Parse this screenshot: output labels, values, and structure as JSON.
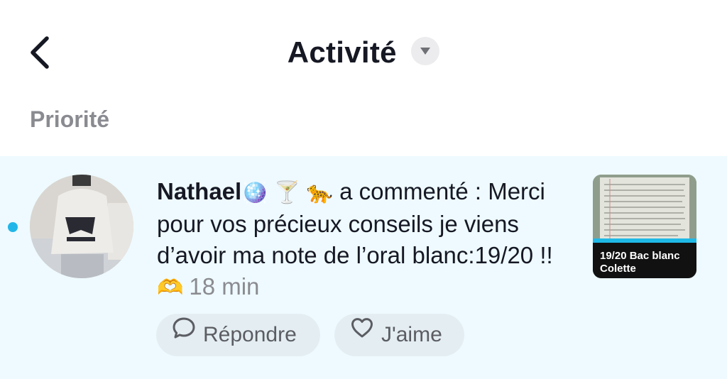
{
  "header": {
    "back_icon": "chevron-left-icon",
    "title": "Activité",
    "dropdown_icon": "caret-down-icon"
  },
  "section": {
    "label": "Priorité"
  },
  "notification": {
    "unread": true,
    "username": "Nathael",
    "username_emojis": "🪩 🍸 🐆",
    "action": " a commenté :",
    "comment": "Merci pour vos précieux conseils je viens d’avoir ma note de l’oral blanc:19/20 !!",
    "comment_emoji": "🫶",
    "time": "18 min",
    "thumbnail_caption": "19/20 Bac blanc Colette",
    "actions": {
      "reply_label": "Répondre",
      "reply_icon": "comment-bubble-icon",
      "like_label": "J'aime",
      "like_icon": "heart-outline-icon"
    }
  },
  "colors": {
    "unread_dot": "#22b6e8",
    "row_background": "#eefaff",
    "muted_text": "#8a8b91"
  }
}
